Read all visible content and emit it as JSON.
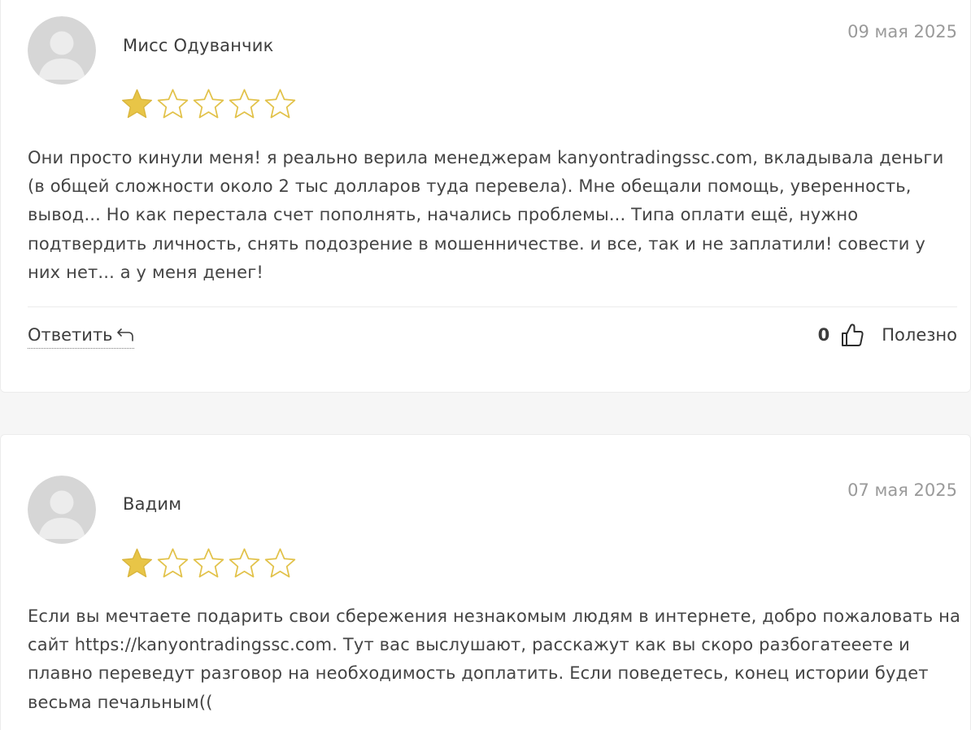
{
  "reviews": [
    {
      "author": "Мисс Одуванчик",
      "date": "09 мая 2025",
      "rating": 1,
      "max_rating": 5,
      "text": "Они просто кинули меня! я реально верила менеджерам kanyontradingssc.com, вкладывала деньги (в общей сложности около 2 тыс долларов туда перевела). Мне обещали помощь, уверенность, вывод... Но как перестала счет пополнять, начались проблемы... Типа оплати ещё, нужно подтвердить личность, снять подозрение в мошенничестве. и все, так и не заплатили! совести у них нет... а у меня денег!",
      "reply_label": "Ответить",
      "likes": "0",
      "helpful_label": "Полезно"
    },
    {
      "author": "Вадим",
      "date": "07 мая 2025",
      "rating": 1,
      "max_rating": 5,
      "text": "Если вы мечтаете подарить свои сбережения незнакомым людям в интернете, добро пожаловать на сайт https://kanyontradingssc.com. Тут вас выслушают, расскажут как вы скоро разбогатееете и плавно переведут разговор на необходимость доплатить. Если поведетесь, конец истории будет весьма печальным(("
    }
  ],
  "colors": {
    "star_filled": "#e8c547",
    "star_outline": "#e2c24a",
    "avatar_bg": "#d6d6d6",
    "avatar_figure": "#ececec"
  },
  "icons": {
    "avatar": "user-silhouette-icon",
    "star": "star-icon",
    "reply": "reply-arrow-icon",
    "like": "thumbs-up-icon"
  }
}
